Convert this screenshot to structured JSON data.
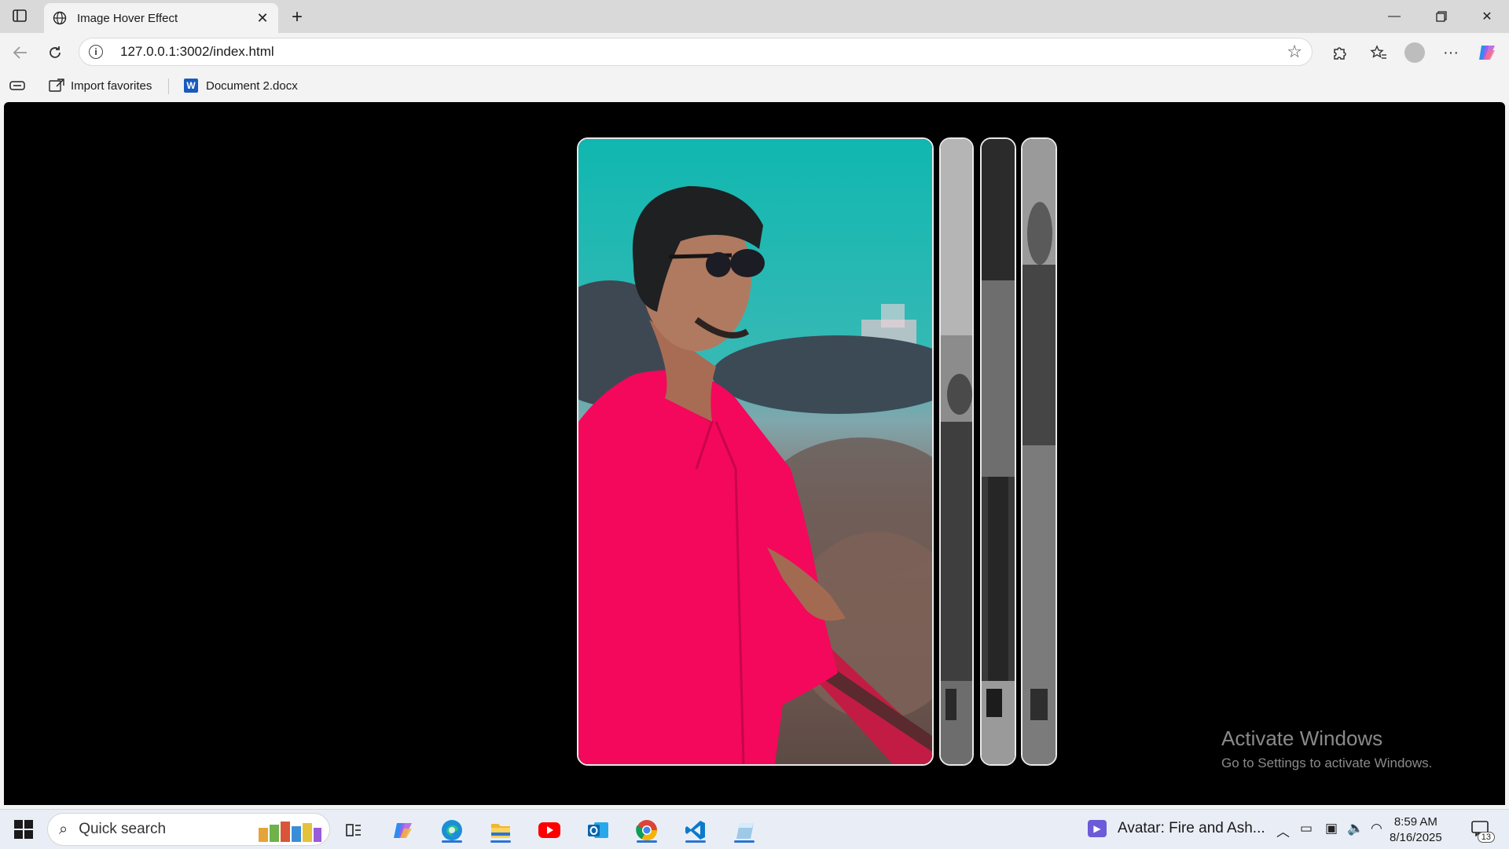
{
  "browser": {
    "tab_title": "Image Hover Effect",
    "url": "127.0.0.1:3002/index.html",
    "favorites": [
      {
        "label": "Import favorites",
        "icon": "import-favorites-icon"
      },
      {
        "label": "Document 2.docx",
        "icon": "word-document-icon"
      }
    ]
  },
  "page": {
    "panels": [
      {
        "state": "expanded",
        "style": "color",
        "description_icon": "portrait-photo"
      },
      {
        "state": "collapsed",
        "style": "grayscale",
        "description_icon": "portrait-photo"
      },
      {
        "state": "collapsed",
        "style": "grayscale",
        "description_icon": "portrait-photo"
      },
      {
        "state": "collapsed",
        "style": "grayscale",
        "description_icon": "portrait-photo"
      }
    ],
    "watermark": {
      "title": "Activate Windows",
      "subtitle": "Go to Settings to activate Windows."
    }
  },
  "taskbar": {
    "search_label": "Quick search",
    "media_title": "Avatar: Fire and Ash...",
    "time": "8:59 AM",
    "date": "8/16/2025",
    "notification_count": "13",
    "apps": [
      "task-view-icon",
      "copilot-icon",
      "edge-icon",
      "file-explorer-icon",
      "youtube-icon",
      "outlook-icon",
      "chrome-icon",
      "vscode-icon",
      "app-icon"
    ]
  },
  "colors": {
    "page_background": "#000000",
    "panel_border": "#e8e8e8",
    "accent": "#2b74d4"
  }
}
